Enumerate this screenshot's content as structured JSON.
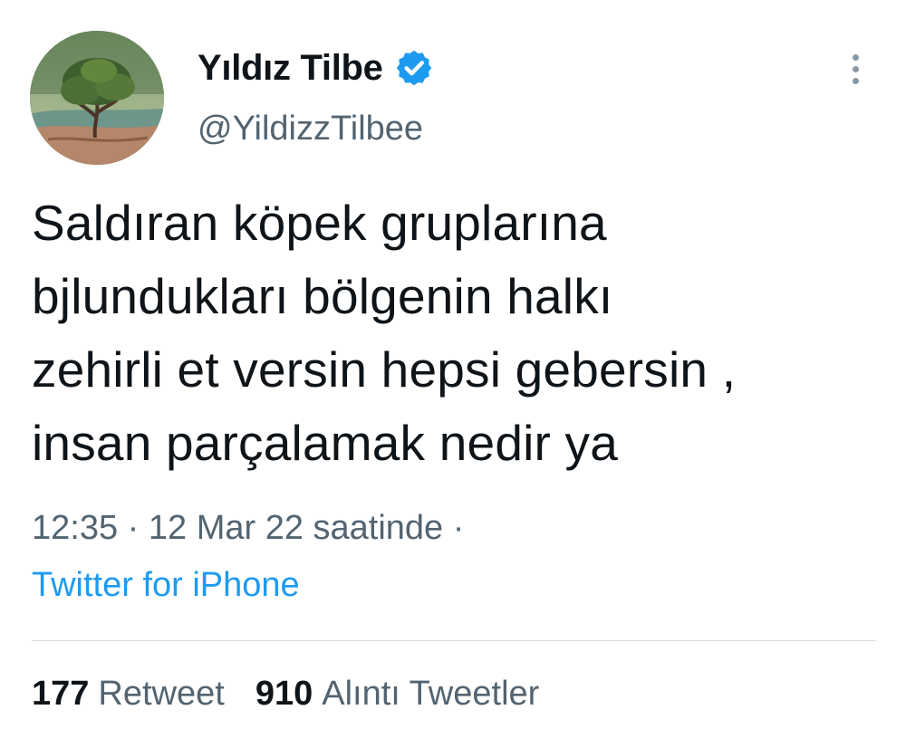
{
  "author": {
    "display_name": "Yıldız Tilbe",
    "handle": "@YildizzTilbee",
    "verified": true,
    "avatar_icon": "tree-landscape-avatar"
  },
  "tweet": {
    "text": "Saldıran köpek gruplarına\nbjlundukları bölgenin halkı\nzehirli et versin hepsi gebersin ,\ninsan parçalamak nedir ya",
    "meta": "12:35 · 12 Mar 22 saatinde ·",
    "source": "Twitter for iPhone"
  },
  "stats": {
    "retweets": {
      "count": "177",
      "label": "Retweet"
    },
    "quotes": {
      "count": "910",
      "label": "Alıntı Tweetler"
    }
  },
  "colors": {
    "accent": "#1d9bf0",
    "secondary_text": "#536471",
    "primary_text": "#0f1419",
    "divider": "#d8dee3"
  },
  "icons": {
    "verified": "verified-badge-icon",
    "more": "more-options-icon"
  }
}
